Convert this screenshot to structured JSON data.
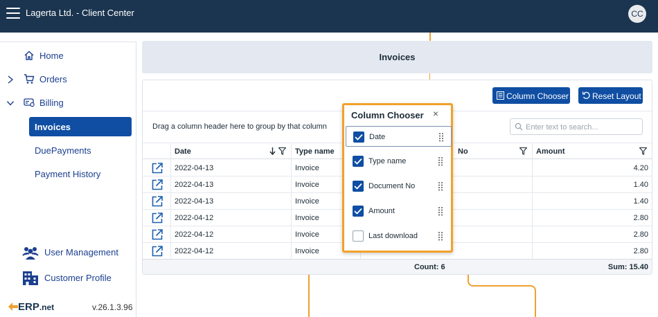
{
  "header": {
    "app_title": "Lagerta Ltd. - Client Center",
    "avatar_initials": "CC"
  },
  "sidebar": {
    "home": "Home",
    "orders": "Orders",
    "billing": "Billing",
    "billing_items": [
      "Invoices",
      "DuePayments",
      "Payment History"
    ],
    "user_management": "User Management",
    "customer_profile": "Customer Profile",
    "brand": {
      "prefix": "ERP",
      "suffix": ".net"
    },
    "version": "v.26.1.3.96"
  },
  "page": {
    "title": "Invoices"
  },
  "toolbar": {
    "column_chooser": "Column Chooser",
    "reset_layout": "Reset Layout"
  },
  "grid": {
    "group_hint": "Drag a column header here to group by that column",
    "search_placeholder": "Enter text to search...",
    "columns": {
      "date": "Date",
      "type": "Type name",
      "doc": "No",
      "amount": "Amount"
    },
    "rows": [
      {
        "date": "2022-04-13",
        "type": "Invoice",
        "amount": "4.20"
      },
      {
        "date": "2022-04-13",
        "type": "Invoice",
        "amount": "1.40"
      },
      {
        "date": "2022-04-13",
        "type": "Invoice",
        "amount": "1.40"
      },
      {
        "date": "2022-04-12",
        "type": "Invoice",
        "amount": "2.80"
      },
      {
        "date": "2022-04-12",
        "type": "Invoice",
        "amount": "2.80"
      },
      {
        "date": "2022-04-12",
        "type": "Invoice",
        "amount": "2.80"
      }
    ],
    "footer": {
      "count": "Count: 6",
      "sum": "Sum: 15.40"
    }
  },
  "column_chooser": {
    "title": "Column Chooser",
    "close": "×",
    "items": [
      {
        "label": "Date",
        "checked": true
      },
      {
        "label": "Type name",
        "checked": true
      },
      {
        "label": "Document No",
        "checked": true
      },
      {
        "label": "Amount",
        "checked": true
      },
      {
        "label": "Last download",
        "checked": false
      }
    ]
  },
  "colors": {
    "topbar": "#1b3550",
    "accent": "#0f4ea3",
    "highlight": "#f2a128"
  }
}
